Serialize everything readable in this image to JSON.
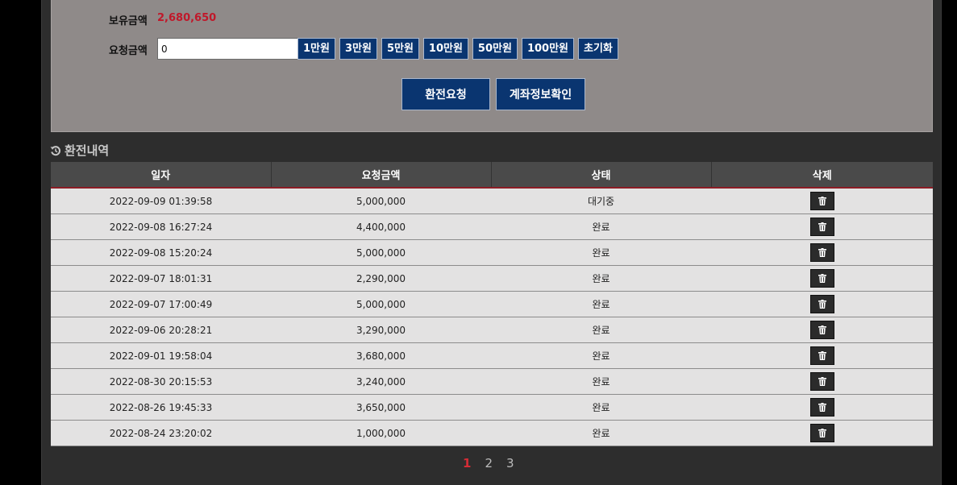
{
  "form": {
    "balance_label": "보유금액",
    "balance_value": "2,680,650",
    "request_label": "요청금액",
    "request_input_value": "0",
    "quick_buttons": [
      "1만원",
      "3만원",
      "5만원",
      "10만원",
      "50만원",
      "100만원",
      "초기화"
    ],
    "exchange_request_button": "환전요청",
    "account_info_button": "계좌정보확인"
  },
  "history": {
    "title": "환전내역",
    "headers": [
      "일자",
      "요청금액",
      "상태",
      "삭제"
    ],
    "rows": [
      {
        "date": "2022-09-09 01:39:58",
        "amount": "5,000,000",
        "status": "대기중"
      },
      {
        "date": "2022-09-08 16:27:24",
        "amount": "4,400,000",
        "status": "완료"
      },
      {
        "date": "2022-09-08 15:20:24",
        "amount": "5,000,000",
        "status": "완료"
      },
      {
        "date": "2022-09-07 18:01:31",
        "amount": "2,290,000",
        "status": "완료"
      },
      {
        "date": "2022-09-07 17:00:49",
        "amount": "5,000,000",
        "status": "완료"
      },
      {
        "date": "2022-09-06 20:28:21",
        "amount": "3,290,000",
        "status": "완료"
      },
      {
        "date": "2022-09-01 19:58:04",
        "amount": "3,680,000",
        "status": "완료"
      },
      {
        "date": "2022-08-30 20:15:53",
        "amount": "3,240,000",
        "status": "완료"
      },
      {
        "date": "2022-08-26 19:45:33",
        "amount": "3,650,000",
        "status": "완료"
      },
      {
        "date": "2022-08-24 23:20:02",
        "amount": "1,000,000",
        "status": "완료"
      }
    ]
  },
  "pagination": {
    "pages": [
      "1",
      "2",
      "3"
    ],
    "current": "1"
  },
  "icons": {
    "section": "history-icon",
    "delete": "trash-icon"
  },
  "colors": {
    "accent_red": "#c0182a",
    "button_navy": "#0a3570",
    "form_bg": "#8f8a89",
    "page_bg": "#2d2d2d"
  }
}
